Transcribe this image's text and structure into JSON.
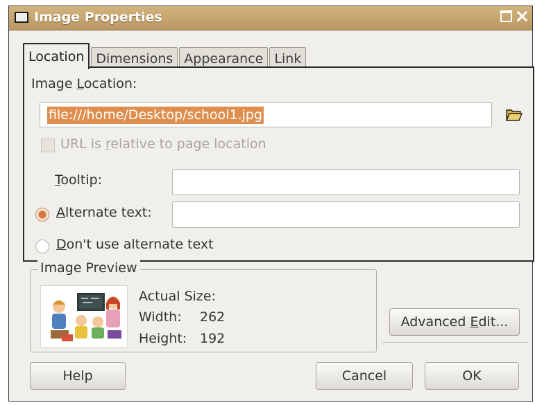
{
  "window": {
    "title": "Image Properties",
    "maximize_icon": "maximize-icon",
    "close_icon": "close-icon"
  },
  "tabs": [
    {
      "label": "Location",
      "active": true
    },
    {
      "label": "Dimensions",
      "active": false
    },
    {
      "label": "Appearance",
      "active": false
    },
    {
      "label": "Link",
      "active": false
    }
  ],
  "location": {
    "image_location_label_pre": "Image ",
    "image_location_label_u": "L",
    "image_location_label_post": "ocation:",
    "image_location_value": "file:///home/Desktop/school1.jpg",
    "browse_icon": "folder-open-icon",
    "relative_url_label_pre": "URL is ",
    "relative_url_label_u": "r",
    "relative_url_label_post": "elative to page location",
    "relative_url_checked": false,
    "tooltip_label_u": "T",
    "tooltip_label_post": "ooltip:",
    "tooltip_value": "",
    "alt_text_label_u": "A",
    "alt_text_label_post": "lternate text:",
    "alt_text_value": "",
    "alt_text_selected": true,
    "no_alt_label_u": "D",
    "no_alt_label_post": "on't use alternate text",
    "no_alt_selected": false
  },
  "preview": {
    "legend": "Image Preview",
    "actual_size_label": "Actual Size:",
    "width_label": "Width:",
    "width_value": "262",
    "height_label": "Height:",
    "height_value": "192"
  },
  "buttons": {
    "advanced_edit_pre": "Advanced ",
    "advanced_edit_u": "E",
    "advanced_edit_post": "dit...",
    "help": "Help",
    "cancel": "Cancel",
    "ok": "OK"
  },
  "colors": {
    "titlebar": "#c8a56f",
    "selection": "#e08e4e",
    "radio_selected": "#d9773b"
  }
}
